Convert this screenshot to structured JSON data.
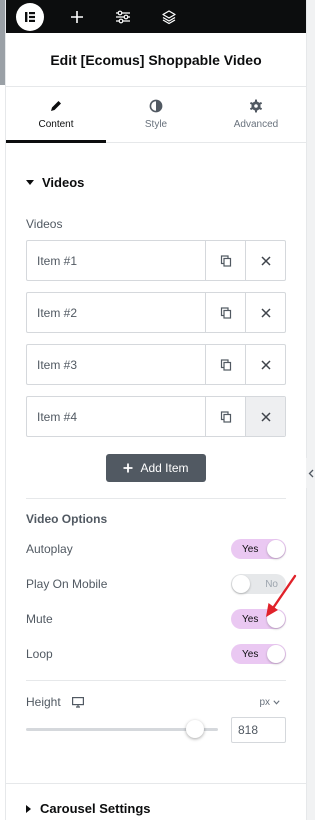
{
  "panel": {
    "title": "Edit [Ecomus] Shoppable Video"
  },
  "toolbar": {
    "icons": [
      "elementor-logo-icon",
      "plus-icon",
      "sliders-icon",
      "layers-icon"
    ]
  },
  "tabs": [
    {
      "label": "Content",
      "icon": "pencil-icon",
      "active": true
    },
    {
      "label": "Style",
      "icon": "half-circle-icon",
      "active": false
    },
    {
      "label": "Advanced",
      "icon": "gear-icon",
      "active": false
    }
  ],
  "videos_section": {
    "title": "Videos",
    "field_label": "Videos",
    "items": [
      {
        "title": "Item #1"
      },
      {
        "title": "Item #2"
      },
      {
        "title": "Item #3"
      },
      {
        "title": "Item #4"
      }
    ],
    "add_label": "Add Item"
  },
  "video_options": {
    "title": "Video Options",
    "toggles": [
      {
        "label": "Autoplay",
        "state": "Yes",
        "on": true
      },
      {
        "label": "Play On Mobile",
        "state": "No",
        "on": false
      },
      {
        "label": "Mute",
        "state": "Yes",
        "on": true
      },
      {
        "label": "Loop",
        "state": "Yes",
        "on": true
      }
    ]
  },
  "height": {
    "label": "Height",
    "unit": "px",
    "value": "818",
    "slider_fraction": 0.88
  },
  "carousel": {
    "title": "Carousel Settings"
  },
  "colors": {
    "accent_toggle": "#eac8f2",
    "annotation_arrow": "#e0222a",
    "topbar": "#0c0d0e"
  }
}
